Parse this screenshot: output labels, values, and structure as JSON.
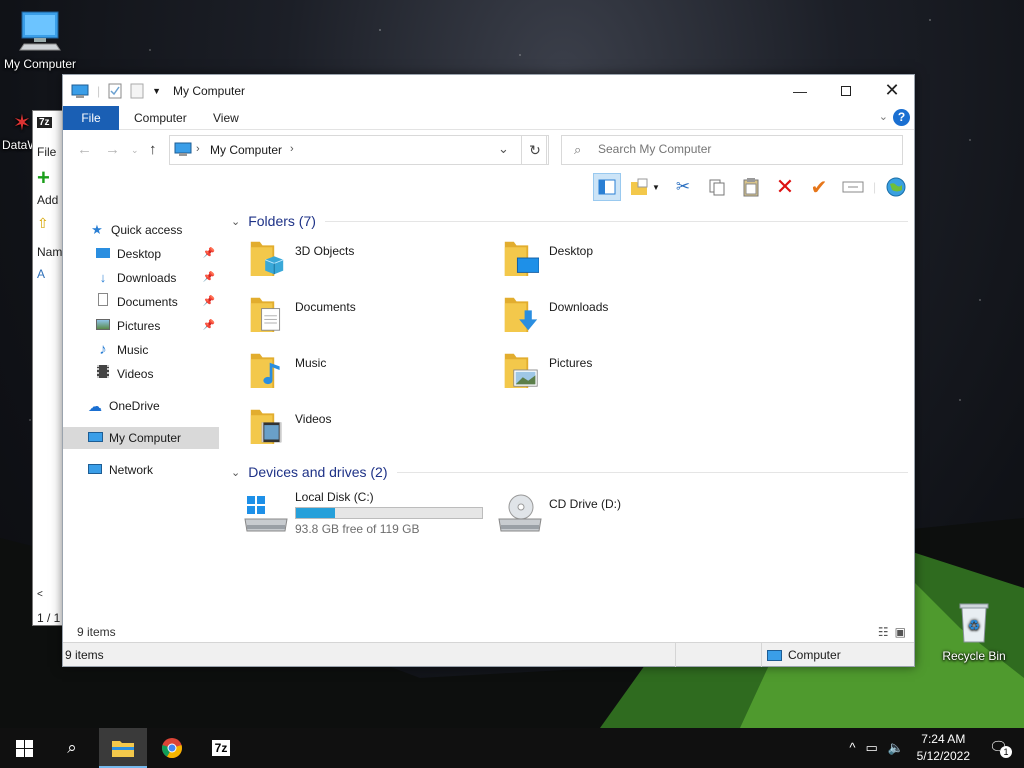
{
  "desktop": {
    "icons": [
      {
        "label": "My Computer",
        "icon": "computer-icon"
      },
      {
        "label": "DataW",
        "icon": "shortcut-icon"
      },
      {
        "label": "Recycle Bin",
        "icon": "recycle-bin-icon"
      }
    ]
  },
  "back_window": {
    "app_icon_label": "7z",
    "menu_file": "File",
    "add_label": "Add",
    "column_name": "Nam",
    "row_label": "A",
    "status": "1 / 1"
  },
  "window": {
    "title": "My Computer",
    "tabs": [
      {
        "label": "File",
        "active": true
      },
      {
        "label": "Computer"
      },
      {
        "label": "View"
      }
    ],
    "help_label": "?",
    "address": {
      "path": "My Computer"
    },
    "search": {
      "placeholder": "Search My Computer"
    },
    "toolbar_icons": [
      "layout-icon",
      "new-folder-icon",
      "cut-icon",
      "copy-icon",
      "paste-icon",
      "delete-icon",
      "check-icon",
      "rename-icon",
      "globe-icon"
    ],
    "nav": {
      "quick_access": "Quick access",
      "items": [
        {
          "label": "Desktop",
          "icon": "desktop-icon",
          "pinned": true
        },
        {
          "label": "Downloads",
          "icon": "downloads-icon",
          "pinned": true
        },
        {
          "label": "Documents",
          "icon": "documents-icon",
          "pinned": true
        },
        {
          "label": "Pictures",
          "icon": "pictures-icon",
          "pinned": true
        },
        {
          "label": "Music",
          "icon": "music-icon",
          "pinned": false
        },
        {
          "label": "Videos",
          "icon": "videos-icon",
          "pinned": false
        }
      ],
      "onedrive": "OneDrive",
      "my_computer": "My Computer",
      "network": "Network"
    },
    "folders_group": "Folders (7)",
    "folders": [
      {
        "name": "3D Objects",
        "overlay": "cube"
      },
      {
        "name": "Desktop",
        "overlay": "monitor"
      },
      {
        "name": "Documents",
        "overlay": "doc"
      },
      {
        "name": "Downloads",
        "overlay": "arrow"
      },
      {
        "name": "Music",
        "overlay": "note"
      },
      {
        "name": "Pictures",
        "overlay": "picture"
      },
      {
        "name": "Videos",
        "overlay": "film"
      }
    ],
    "drives_group": "Devices and drives (2)",
    "drives": [
      {
        "name": "Local Disk (C:)",
        "free_text": "93.8 GB free of 119 GB",
        "used_fraction": 0.21
      },
      {
        "name": "CD Drive (D:)"
      }
    ],
    "item_count": "9 items",
    "statusbar": {
      "left": "9 items",
      "right": "Computer"
    }
  },
  "taskbar": {
    "time": "7:24 AM",
    "date": "5/12/2022",
    "notification_count": "1",
    "apps": [
      "start-icon",
      "search-icon",
      "file-explorer-icon",
      "chrome-icon",
      "7zip-icon"
    ],
    "seven_zip_label": "7z"
  },
  "colors": {
    "accent": "#1a5fb4",
    "folder": "#f3c84b",
    "drive_fill": "#26a0da"
  }
}
